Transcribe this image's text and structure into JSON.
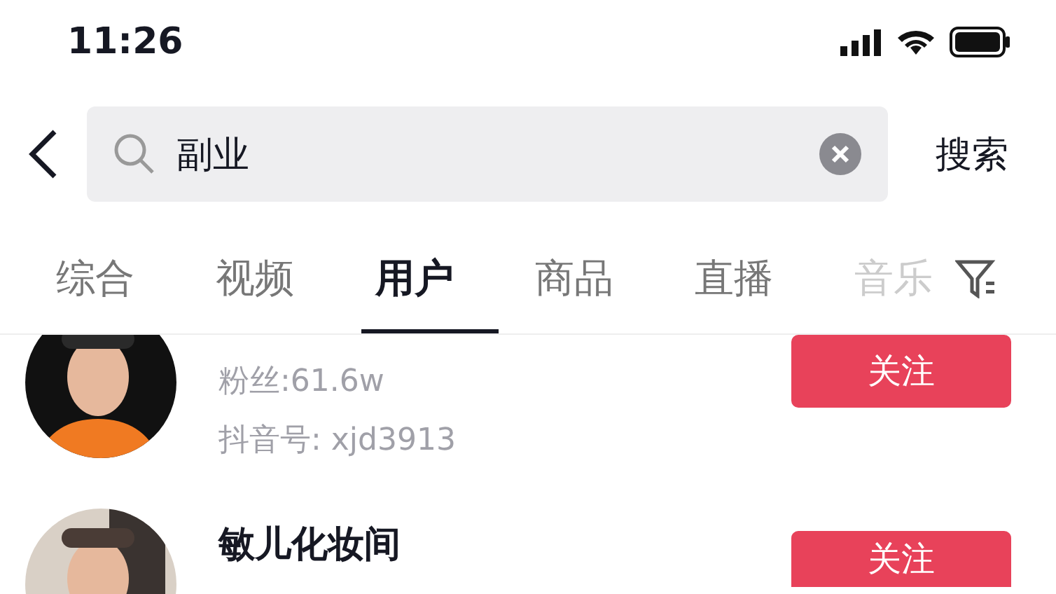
{
  "status_bar": {
    "time": "11:26"
  },
  "search": {
    "value": "副业",
    "action": "搜索"
  },
  "tabs": [
    {
      "label": "综合",
      "selected": false,
      "faded": false
    },
    {
      "label": "视频",
      "selected": false,
      "faded": false
    },
    {
      "label": "用户",
      "selected": true,
      "faded": false
    },
    {
      "label": "商品",
      "selected": false,
      "faded": false
    },
    {
      "label": "直播",
      "selected": false,
      "faded": false
    },
    {
      "label": "音乐",
      "selected": false,
      "faded": true
    }
  ],
  "users": [
    {
      "details": [
        "粉丝:61.6w",
        "抖音号: xjd3913"
      ],
      "button": "关注"
    },
    {
      "name": "敏儿化妆间",
      "button": "关注"
    }
  ]
}
